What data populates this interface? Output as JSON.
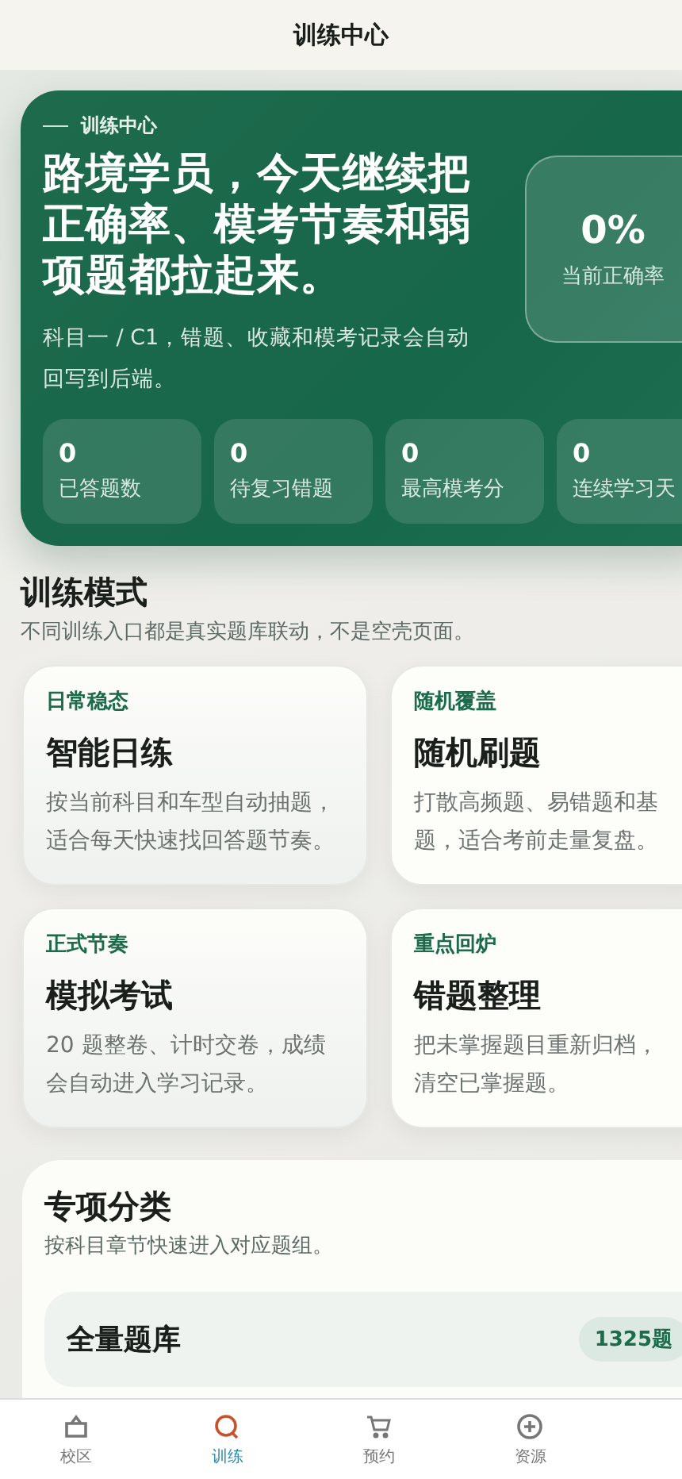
{
  "nav": {
    "title": "训练中心"
  },
  "hero": {
    "eyebrow": "训练中心",
    "headline": "路境学员，今天继续把正确率、模考节奏和弱项题都拉起来。",
    "subtitle": "科目一 / C1，错题、收藏和模考记录会自动回写到后端。",
    "accuracy": {
      "value": "0%",
      "label": "当前正确率"
    },
    "stats": [
      {
        "value": "0",
        "label": "已答题数"
      },
      {
        "value": "0",
        "label": "待复习错题"
      },
      {
        "value": "0",
        "label": "最高模考分"
      },
      {
        "value": "0",
        "label": "连续学习天"
      }
    ]
  },
  "modes": {
    "title": "训练模式",
    "subtitle": "不同训练入口都是真实题库联动，不是空壳页面。",
    "cards": [
      {
        "tag": "日常稳态",
        "title": "智能日练",
        "description": "按当前科目和车型自动抽题，适合每天快速找回答题节奏。"
      },
      {
        "tag": "随机覆盖",
        "title": "随机刷题",
        "description": "打散高频题、易错题和基题，适合考前走量复盘。"
      },
      {
        "tag": "正式节奏",
        "title": "模拟考试",
        "description": "20 题整卷、计时交卷，成绩会自动进入学习记录。"
      },
      {
        "tag": "重点回炉",
        "title": "错题整理",
        "description": "把未掌握题目重新归档，清空已掌握题。"
      }
    ]
  },
  "categories": {
    "title": "专项分类",
    "subtitle": "按科目章节快速进入对应题组。",
    "items": [
      {
        "name": "全量题库",
        "count": "1325题"
      }
    ]
  },
  "tab_bar": [
    {
      "label": "校区",
      "kind": "house",
      "selected": false
    },
    {
      "label": "训练",
      "kind": "search",
      "selected": true
    },
    {
      "label": "预约",
      "kind": "cart",
      "selected": false
    },
    {
      "label": "资源",
      "kind": "plus",
      "selected": false
    }
  ]
}
